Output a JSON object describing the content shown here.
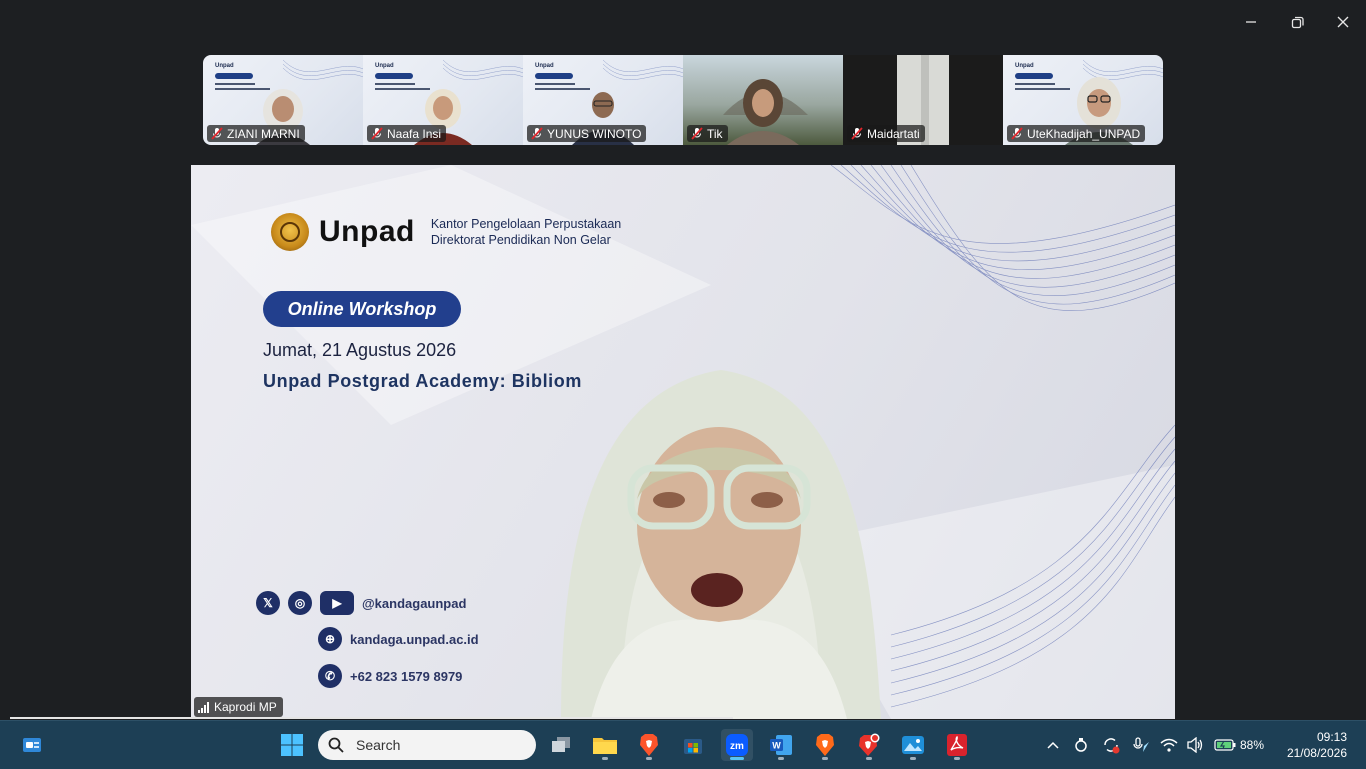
{
  "window": {
    "controls": [
      "minimize",
      "restore",
      "close"
    ]
  },
  "gallery": [
    {
      "name": "ZIANI MARNI",
      "muted": true
    },
    {
      "name": "Naafa Insi",
      "muted": true
    },
    {
      "name": "YUNUS WINOTO",
      "muted": true
    },
    {
      "name": "Tik",
      "muted": true
    },
    {
      "name": "Maidartati",
      "muted": true
    },
    {
      "name": "UteKhadijah_UNPAD",
      "muted": true
    }
  ],
  "slide": {
    "brand": "Unpad",
    "org_line1": "Kantor Pengelolaan Perpustakaan",
    "org_line2": "Direktorat Pendidikan Non Gelar",
    "badge": "Online Workshop",
    "date": "Jumat, 21 Agustus 2026",
    "title": "Unpad Postgrad Academy: Bibliom",
    "social_handle": "@kandagaunpad",
    "website": "kandaga.unpad.ac.id",
    "phone": "+62 823 1579 8979",
    "colors": {
      "navy": "#223f8d",
      "gold": "#d9a22c"
    }
  },
  "speaker": {
    "name": "Kaprodi MP"
  },
  "taskbar": {
    "search_placeholder": "Search",
    "battery": "88%",
    "time": "09:13",
    "date": "21/08/2026",
    "apps": [
      "widgets-icon",
      "start-icon",
      "search",
      "task-view-icon",
      "file-explorer-icon",
      "brave-browser-icon",
      "microsoft-store-icon",
      "zoom-icon",
      "word-icon",
      "brave-icon",
      "brave-beta-icon",
      "photos-icon",
      "acrobat-icon"
    ]
  }
}
